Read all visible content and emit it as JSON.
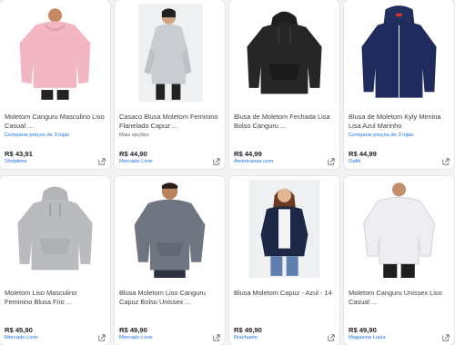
{
  "products": [
    {
      "title": "Moletom Canguru Masculino Liso\nCasual ...",
      "compare": "Comparar preços de 3 lojas",
      "more": "",
      "price": "R$ 43,91",
      "store": "Shoptime",
      "image": "pink-hoodie",
      "color": "#f3b7c3"
    },
    {
      "title": "Casaco Blusa Moletom Feminino\nFlanelado Capuz ...",
      "compare": "",
      "more": "Mais opções",
      "price": "R$ 44,90",
      "store": "Mercado Livre",
      "image": "gray-hoodie-model",
      "color": "#c9ccd1"
    },
    {
      "title": "Blusa de Moletom Fechada Lisa\nBolso Canguru ...",
      "compare": "",
      "more": "",
      "price": "R$ 44,99",
      "store": "Americanas.com",
      "image": "black-hoodie",
      "color": "#1f1f1f"
    },
    {
      "title": "Blusa de Moletom Kyly Menina\nLisa Azul Marinho",
      "compare": "Comparar preços de 3 lojas",
      "more": "",
      "price": "R$ 44,99",
      "store": "Dafiti",
      "image": "navy-hoodie",
      "color": "#1e2b5c"
    },
    {
      "title": "Moletom Liso Masculino\nFeminino Blusa Frio ...",
      "compare": "",
      "more": "",
      "price": "R$ 45,90",
      "store": "Mercado Livre",
      "image": "light-gray-hoodie",
      "color": "#b9bbbe"
    },
    {
      "title": "Blusa Moletom Liso Canguru\nCapuz Bolso Unissex ...",
      "compare": "",
      "more": "",
      "price": "R$ 49,90",
      "store": "Mercado Livre",
      "image": "gray-hoodie-man",
      "color": "#6f7681"
    },
    {
      "title": "Blusa Moletom Capuz - Azul - 14",
      "compare": "",
      "more": "",
      "price": "R$ 49,90",
      "store": "Riachuelo",
      "image": "navy-cardigan-model",
      "color": "#1d2746"
    },
    {
      "title": "Moletom Canguru Unissex Liso\nCasual ...",
      "compare": "",
      "more": "",
      "price": "R$ 49,90",
      "store": "Magazine Luiza",
      "image": "white-hoodie-man",
      "color": "#eeeef2"
    }
  ],
  "icons": {
    "external": "open-in-new-icon"
  }
}
